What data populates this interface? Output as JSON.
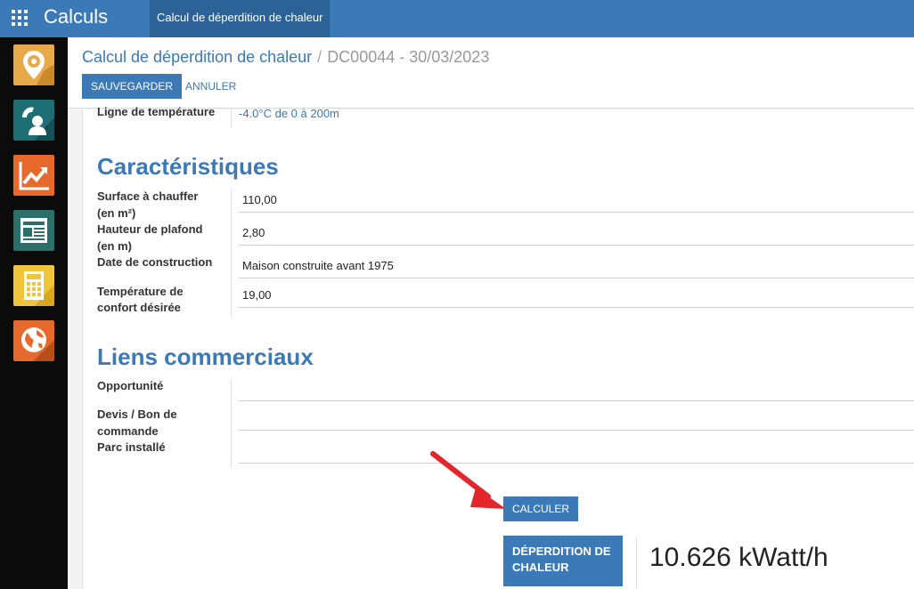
{
  "app": {
    "title": "Calculs",
    "active_menu": "Calcul de déperdition de chaleur"
  },
  "sidebar": {
    "apps": [
      {
        "icon": "location-gear-icon",
        "color": "#e8a94a"
      },
      {
        "icon": "phone-user-icon",
        "color": "#1e6f74"
      },
      {
        "icon": "trending-chart-icon",
        "color": "#e8692c"
      },
      {
        "icon": "newspaper-icon",
        "color": "#2a6f6a"
      },
      {
        "icon": "calculator-icon",
        "color": "#f0c53a"
      },
      {
        "icon": "globe-icon",
        "color": "#e8692c"
      }
    ]
  },
  "breadcrumb": {
    "parent": "Calcul de déperdition de chaleur",
    "separator": "/",
    "current": "DC00044 - 30/03/2023"
  },
  "buttons": {
    "save": "SAUVEGARDER",
    "cancel": "ANNULER",
    "calculate": "CALCULER"
  },
  "form": {
    "temperature_line": {
      "label": "Ligne de température",
      "value": "-4.0°C de 0 à 200m"
    },
    "characteristics": {
      "title": "Caractéristiques",
      "fields": [
        {
          "label1": "Surface à chauffer",
          "label2": "(en m²)",
          "value": "110,00"
        },
        {
          "label1": "Hauteur de plafond",
          "label2": "(en m)",
          "value": "2,80"
        },
        {
          "label1": "Date de construction",
          "label2": "",
          "value": "Maison construite avant 1975"
        },
        {
          "label1": "Température de",
          "label2": "confort désirée",
          "value": "19,00"
        }
      ]
    },
    "commercial_links": {
      "title": "Liens commerciaux",
      "fields": [
        {
          "label1": "Opportunité",
          "label2": "",
          "label3": "",
          "value": ""
        },
        {
          "label1": "Devis / Bon de",
          "label2": "commande",
          "label3": "",
          "value": ""
        },
        {
          "label1": "Parc installé",
          "label2": "",
          "label3": "",
          "value": ""
        }
      ]
    },
    "result": {
      "label1": "DÉPERDITION DE",
      "label2": "CHALEUR",
      "value": "10.626 kWatt/h"
    }
  },
  "colors": {
    "brand": "#3b79b7",
    "annotation_arrow": "#e3262b"
  }
}
